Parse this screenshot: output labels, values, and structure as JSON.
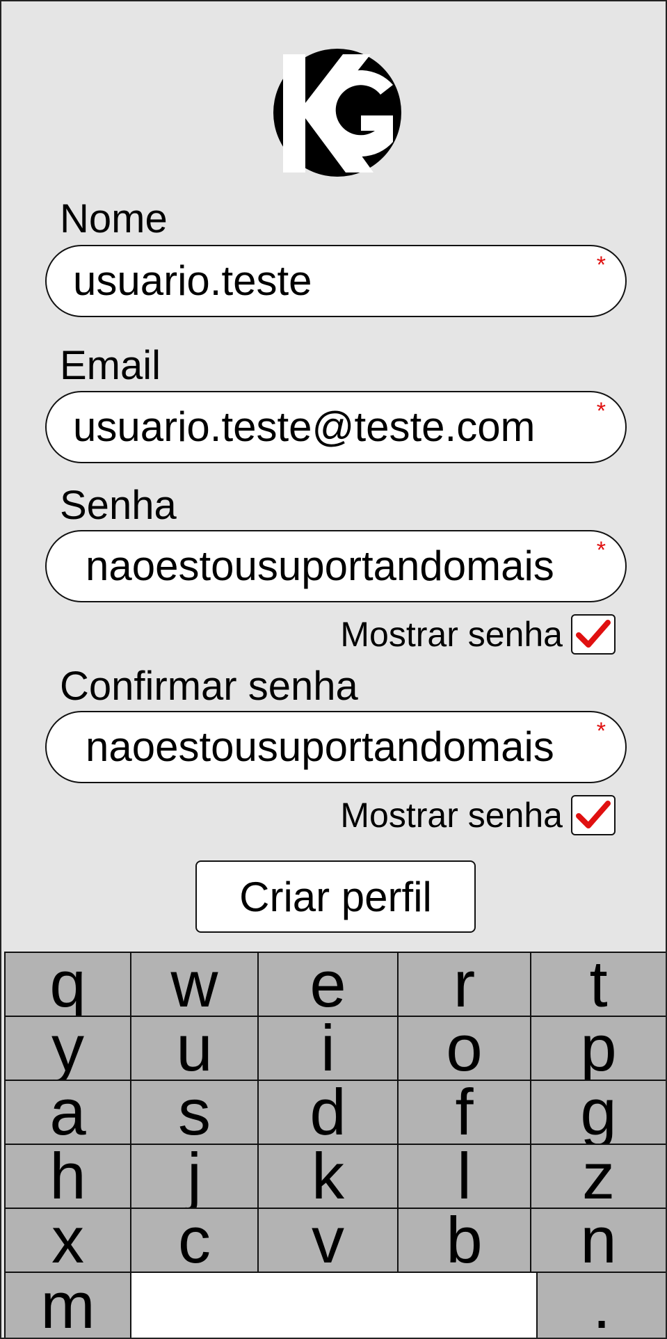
{
  "logo": {
    "text": "KG"
  },
  "form": {
    "name": {
      "label": "Nome",
      "value": "usuario.teste",
      "required_mark": "*"
    },
    "email": {
      "label": "Email",
      "value": "usuario.teste@teste.com",
      "required_mark": "*"
    },
    "password": {
      "label": "Senha",
      "value": "naoestousuportandomais",
      "required_mark": "*",
      "show_label": "Mostrar senha",
      "show_checked": true
    },
    "confirm_password": {
      "label": "Confirmar senha",
      "value": "naoestousuportandomais",
      "required_mark": "*",
      "show_label": "Mostrar senha",
      "show_checked": true
    },
    "submit_label": "Criar perfil"
  },
  "colors": {
    "background": "#e5e5e5",
    "required": "#e01010",
    "check": "#e01010",
    "key": "#b3b3b3"
  },
  "keyboard": {
    "rows": [
      [
        "q",
        "w",
        "e",
        "r",
        "t"
      ],
      [
        "y",
        "u",
        "i",
        "o",
        "p"
      ],
      [
        "a",
        "s",
        "d",
        "f",
        "g"
      ],
      [
        "h",
        "j",
        "k",
        "l",
        "z"
      ],
      [
        "x",
        "c",
        "v",
        "b",
        "n"
      ]
    ],
    "bottom": {
      "left": "m",
      "space": "",
      "right": "."
    }
  }
}
